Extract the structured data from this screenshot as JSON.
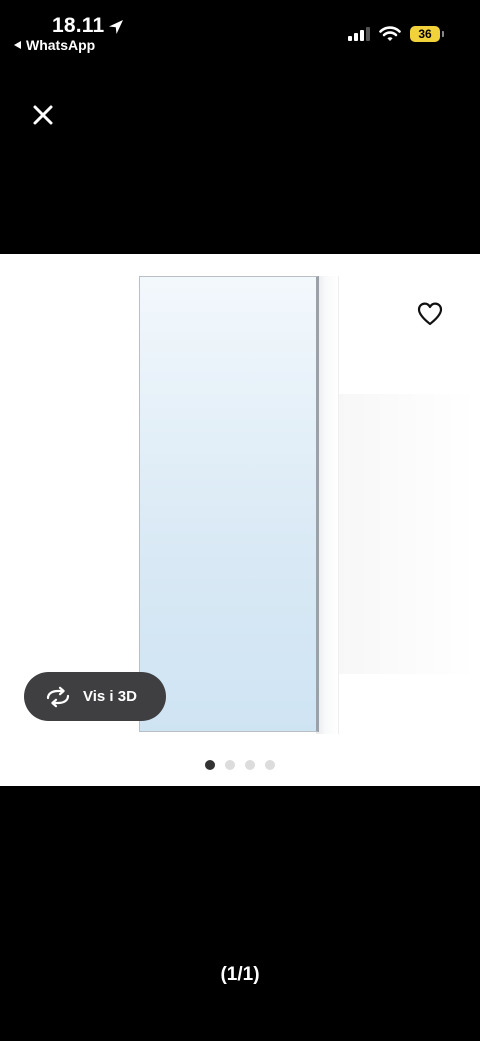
{
  "status_bar": {
    "time": "18.11",
    "back_app": "WhatsApp",
    "battery": "36"
  },
  "colors": {
    "battery": "#f2d23b",
    "background": "#000000",
    "view3d_button": "#3f3f41"
  },
  "viewer": {
    "close_icon": "close-icon",
    "favorite_icon": "heart-icon",
    "view3d_label": "Vis i 3D",
    "view3d_icon": "rotate-icon",
    "page_dots_total": 4,
    "page_dot_active": 1,
    "counter": "(1/1)"
  }
}
